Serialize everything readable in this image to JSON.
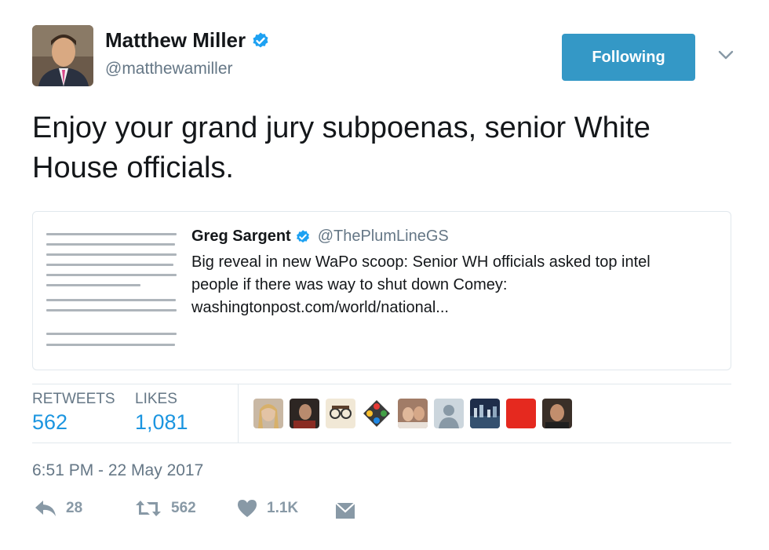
{
  "author": {
    "name": "Matthew Miller",
    "handle": "@matthewamiller",
    "follow_label": "Following"
  },
  "tweet": {
    "text": "Enjoy your grand jury subpoenas, senior White House officials.",
    "timestamp": "6:51 PM - 22 May 2017"
  },
  "quoted": {
    "name": "Greg Sargent",
    "handle": "@ThePlumLineGS",
    "text_line1": "Big reveal in new WaPo scoop: Senior WH officials asked top intel",
    "text_line2": "people if there was way to shut down Comey:",
    "text_line3": "washingtonpost.com/world/national..."
  },
  "stats": {
    "retweets_label": "RETWEETS",
    "retweets_value": "562",
    "likes_label": "LIKES",
    "likes_value": "1,081"
  },
  "actions": {
    "reply_count": "28",
    "retweet_count": "562",
    "like_count": "1.1K"
  },
  "colors": {
    "accent": "#1b95e0",
    "follow_button": "#3498c6",
    "muted": "#657786",
    "action_gray": "#8899a6",
    "verified": "#1da1f2"
  },
  "icons": [
    "verified-badge-icon",
    "chevron-down-icon",
    "reply-icon",
    "retweet-icon",
    "heart-icon",
    "direct-message-icon"
  ]
}
